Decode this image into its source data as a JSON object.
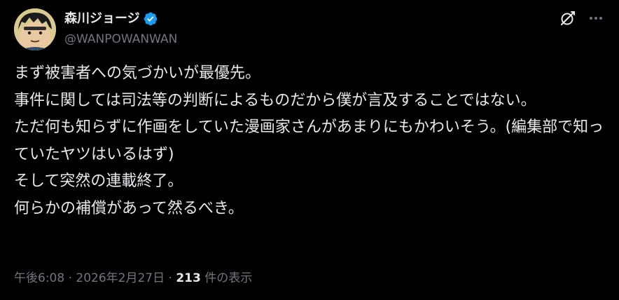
{
  "author": {
    "display_name": "森川ジョージ",
    "handle": "@WANPOWANWAN",
    "verified": true
  },
  "icons": {
    "grok": "grok-icon",
    "more": "more-icon",
    "verified": "verified-badge-icon",
    "avatar": "avatar-image"
  },
  "colors": {
    "background": "#000000",
    "text": "#e7e9ea",
    "secondary": "#71767b",
    "verified": "#1d9bf0"
  },
  "tweet": {
    "text": "まず被害者への気づかいが最優先。\n事件に関しては司法等の判断によるものだから僕が言及することではない。\nただ何も知らずに作画をしていた漫画家さんがあまりにもかわいそう。(編集部で知っていたヤツはいるはず)\nそして突然の連載終了。\n何らかの補償があって然るべき。"
  },
  "meta": {
    "time": "午後6:08",
    "separator1": " · ",
    "date": "2026年2月27日",
    "separator2": " · ",
    "views_count": "213",
    "views_label": " 件の表示"
  }
}
